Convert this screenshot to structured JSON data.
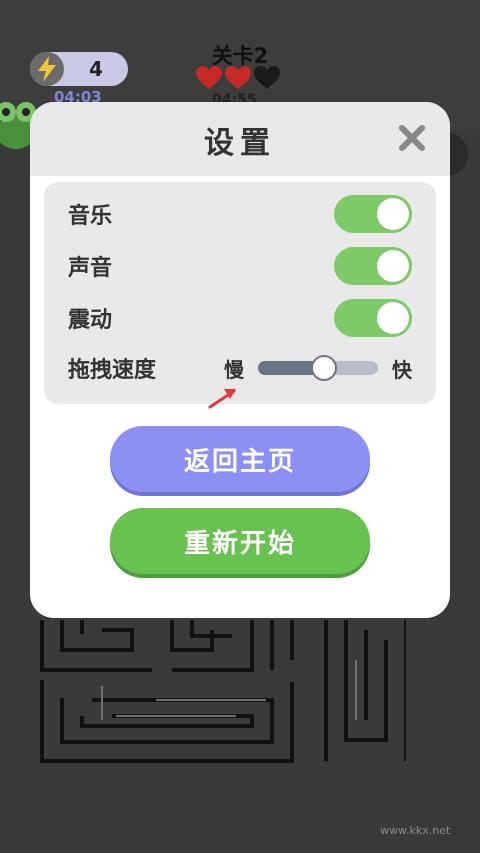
{
  "hud": {
    "energy_count": "4",
    "energy_timer": "04:03",
    "level_title": "关卡2",
    "level_timer": "04:55",
    "hearts": [
      "filled",
      "filled",
      "empty"
    ]
  },
  "dialog": {
    "title": "设置",
    "settings": [
      {
        "label": "音乐",
        "enabled": true
      },
      {
        "label": "声音",
        "enabled": true
      },
      {
        "label": "震动",
        "enabled": true
      }
    ],
    "drag_speed": {
      "label": "拖拽速度",
      "min_label": "慢",
      "max_label": "快",
      "value_fraction": 0.5
    },
    "home_button": "返回主页",
    "restart_button": "重新开始"
  },
  "colors": {
    "toggle_on": "#7fca68",
    "home_button": "#8b90f2",
    "restart_button": "#69c150",
    "heart_filled": "#c62828",
    "heart_empty": "#1a1a1a"
  },
  "watermark": "www.kkx.net"
}
